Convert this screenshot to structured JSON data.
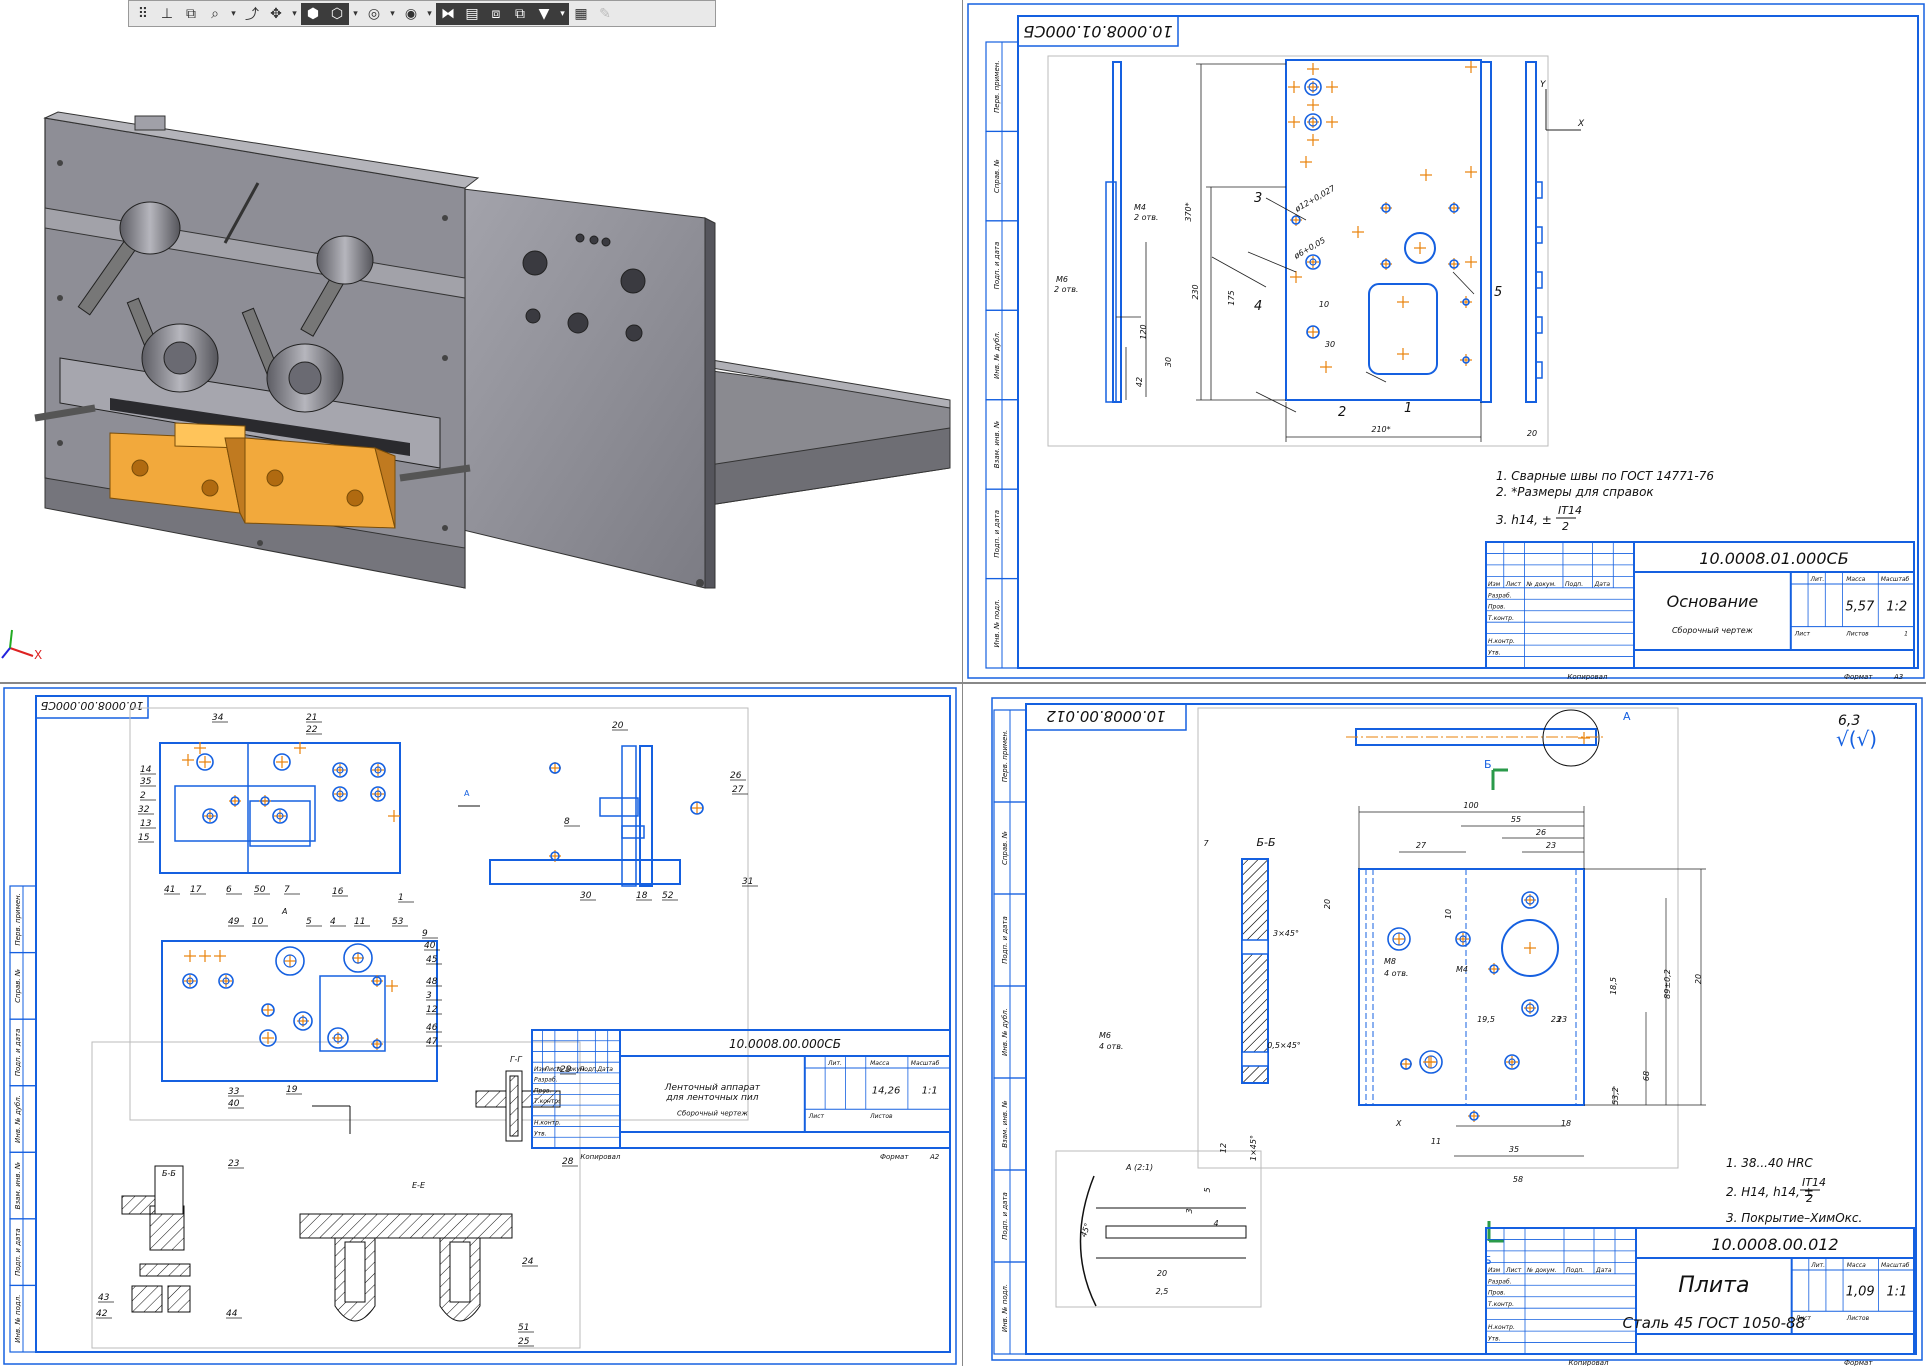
{
  "toolbar": {
    "icons": [
      "grid-icon",
      "axis-icon",
      "view-orient-icon",
      "zoom-icon",
      "dropdown",
      "rotate-icon",
      "pan-icon",
      "dropdown",
      "shaded-view-icon",
      "wireframe-view-icon",
      "dropdown",
      "hide-show-icon",
      "dropdown",
      "display-style-icon",
      "dropdown",
      "section-view-icon",
      "layers-icon",
      "view-settings-icon",
      "filter-view-icon",
      "filter-icon",
      "dropdown",
      "properties-icon",
      "pencil-icon"
    ],
    "glyphs": [
      "⠿",
      "⊥",
      "⧉",
      "⌕",
      "▾",
      "⤴",
      "✥",
      "▾",
      "⬢",
      "⬡",
      "▾",
      "◎",
      "▾",
      "◉",
      "▾",
      "⧓",
      "▤",
      "⧈",
      "⧉",
      "▼",
      "▾",
      "▦",
      "✎"
    ]
  },
  "colors": {
    "line": "#1560e0",
    "center": "#e8820a",
    "part": "#f2a93c",
    "metal": "#8c8c94"
  },
  "pane3d": {
    "axis_x": "X"
  },
  "sheet_main": {
    "stamp_code": "10.0008.01.000СБ",
    "title": "Основание",
    "subtitle": "Сборочный чертеж",
    "mass": "5,57",
    "scale": "1:2",
    "sheets": "1",
    "format": "А3",
    "notes": [
      "1. Сварные швы по ГОСТ 14771-76",
      "2. *Размеры для справок",
      "3. h14, ±",
      "IT14",
      "2"
    ],
    "dims": [
      "210*",
      "370*",
      "230",
      "10",
      "30",
      "175",
      "120",
      "20",
      "42",
      "30"
    ],
    "labels": [
      "М4",
      "2 отв.",
      "М6",
      "2 отв.",
      "1",
      "2",
      "3",
      "4",
      "5",
      "Y",
      "X",
      "ø12+0,027",
      "ø6+0,05"
    ],
    "stamp_headers": [
      "Лит.",
      "Масса",
      "Масштаб",
      "Изм",
      "Лист",
      "№ докум.",
      "Подп.",
      "Дата",
      "Разраб.",
      "Пров.",
      "Т.контр.",
      "Н.контр.",
      "Утв.",
      "Лист",
      "Листов",
      "Копировал",
      "Формат"
    ],
    "side_labels": [
      "Перв. примен.",
      "Справ. №",
      "Подп. и дата",
      "Инв. № дубл.",
      "Взам. инв. №",
      "Подп. и дата",
      "Инв. № подл."
    ]
  },
  "sheet_assembly": {
    "stamp_code": "10.0008.00.000СБ",
    "title": "Ленточный аппарат",
    "title2": "для ленточных пил",
    "subtitle": "Сборочный чертеж",
    "mass": "14,26",
    "scale": "1:1",
    "format": "А2",
    "copied": "Копировал",
    "callouts": [
      "34",
      "21",
      "22",
      "14",
      "35",
      "2",
      "32",
      "13",
      "15",
      "41",
      "17",
      "6",
      "50",
      "7",
      "16",
      "1",
      "20",
      "26",
      "27",
      "8",
      "30",
      "18",
      "52",
      "31",
      "49",
      "10",
      "5",
      "4",
      "11",
      "53",
      "9",
      "40",
      "45",
      "48",
      "3",
      "12",
      "46",
      "47",
      "33",
      "40",
      "19",
      "23",
      "43",
      "42",
      "44",
      "24",
      "51",
      "25",
      "29",
      "28"
    ],
    "sections": [
      "А",
      "Г-Г",
      "Б-Б",
      "Е-Е",
      "А"
    ]
  },
  "sheet_plate": {
    "stamp_code": "10.0008.00.012",
    "title": "Плита",
    "material": "Сталь 45 ГОСТ 1050-88",
    "mass": "1,09",
    "scale": "1:1",
    "roughness": "6,3",
    "roughness_sym": "√(√)",
    "notes": [
      "1. 38...40 HRC",
      "2. Н14, h14, ±",
      "IT14",
      "2",
      "3. Покрытие–ХимОкс."
    ],
    "section_label": "Б-Б",
    "section_mark": "Б",
    "detail_label": "А",
    "detail_scale": "А (2:1)",
    "dims": [
      "100",
      "55",
      "26",
      "23",
      "27",
      "20",
      "10",
      "23",
      "19,5",
      "23",
      "18,5",
      "35",
      "58",
      "11",
      "18",
      "20",
      "89±0,2",
      "68",
      "53,2",
      "7",
      "3×45°",
      "0,5×45°",
      "1×45°",
      "12",
      "20",
      "2,5",
      "5",
      "3",
      "4",
      "45°"
    ],
    "labels": [
      "М8",
      "4 отв.",
      "М4",
      "М6",
      "4 отв.",
      "X"
    ]
  }
}
